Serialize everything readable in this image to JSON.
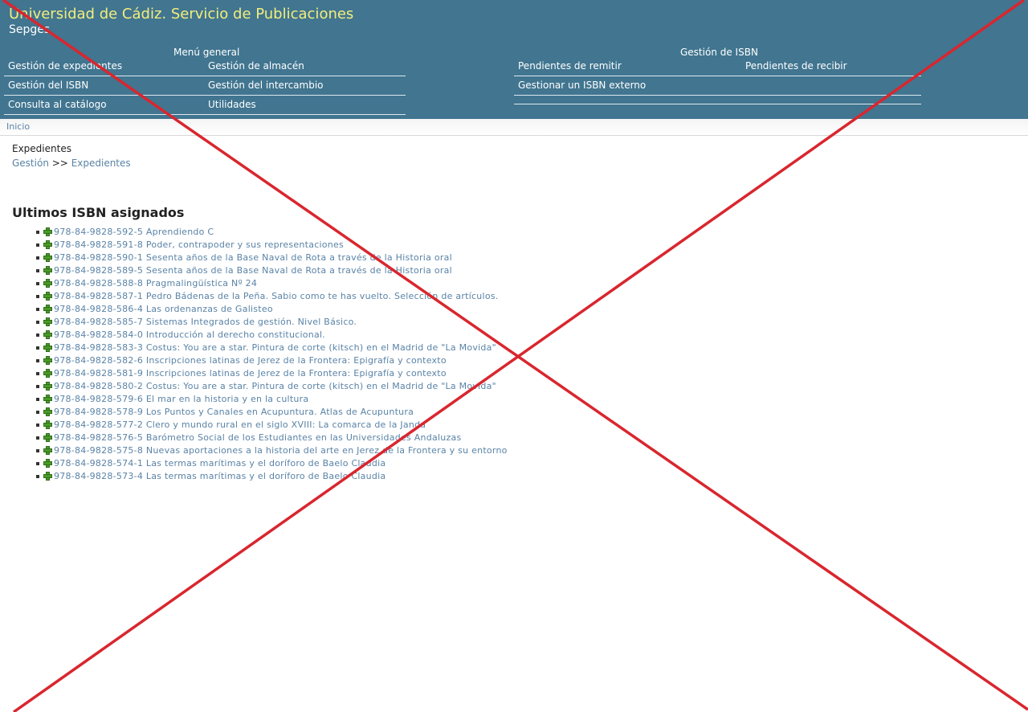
{
  "app": {
    "title": "Universidad de Cádiz. Servicio de Publicaciones",
    "subtitle": "Sepges"
  },
  "menus": {
    "general": {
      "heading": "Menú general",
      "items": [
        "Gestión de expedientes",
        "Gestión de almacén",
        "Gestión del ISBN",
        "Gestión del intercambio",
        "Consulta al catálogo",
        "Utilidades"
      ]
    },
    "isbn": {
      "heading": "Gestión de ISBN",
      "items": [
        "Pendientes de remitir",
        "Pendientes de recibir",
        "Gestionar un ISBN externo"
      ]
    }
  },
  "breadcrumb": {
    "home": "Inicio"
  },
  "page": {
    "section": "Expedientes",
    "path": [
      "Gestión",
      ">>",
      "Expedientes"
    ],
    "list_title": "Ultimos ISBN asignados"
  },
  "isbn_list": [
    "978-84-9828-592-5 Aprendiendo C",
    "978-84-9828-591-8 Poder, contrapoder y sus representaciones",
    "978-84-9828-590-1 Sesenta años de la Base Naval de Rota a través de la Historia oral",
    "978-84-9828-589-5 Sesenta años de la Base Naval de Rota a través de la Historia oral",
    "978-84-9828-588-8 Pragmalingüística Nº 24",
    "978-84-9828-587-1 Pedro Bádenas de la Peña. Sabio como te has vuelto. Selección de artículos.",
    "978-84-9828-586-4 Las ordenanzas de Galisteo",
    "978-84-9828-585-7 Sistemas Integrados de gestión. Nivel Básico.",
    "978-84-9828-584-0 Introducción al derecho constitucional.",
    "978-84-9828-583-3 Costus: You are a star. Pintura de corte (kitsch) en el Madrid de \"La Movida\"",
    "978-84-9828-582-6 Inscripciones latinas de Jerez de la Frontera: Epigrafía y contexto",
    "978-84-9828-581-9 Inscripciones latinas de Jerez de la Frontera: Epigrafía y contexto",
    "978-84-9828-580-2 Costus: You are a star. Pintura de corte (kitsch) en el Madrid de \"La Movida\"",
    "978-84-9828-579-6 El mar en la historia y en la cultura",
    "978-84-9828-578-9 Los Puntos y Canales en Acupuntura. Atlas de Acupuntura",
    "978-84-9828-577-2 Clero y mundo rural en el siglo XVIII: La comarca de la Janda",
    "978-84-9828-576-5 Barómetro Social de los Estudiantes en las Universidades Andaluzas",
    "978-84-9828-575-8 Nuevas aportaciones a la historia del arte en Jerez de la Frontera y su entorno",
    "978-84-9828-574-1 Las termas marítimas y el doríforo de Baelo Claudia",
    "978-84-9828-573-4 Las termas marítimas y el doríforo de Baelo Claudia"
  ],
  "colors": {
    "header_bg": "#417590",
    "title": "#f2ee7c",
    "link": "#5a83a6",
    "overlay_cross": "#d9262e"
  }
}
